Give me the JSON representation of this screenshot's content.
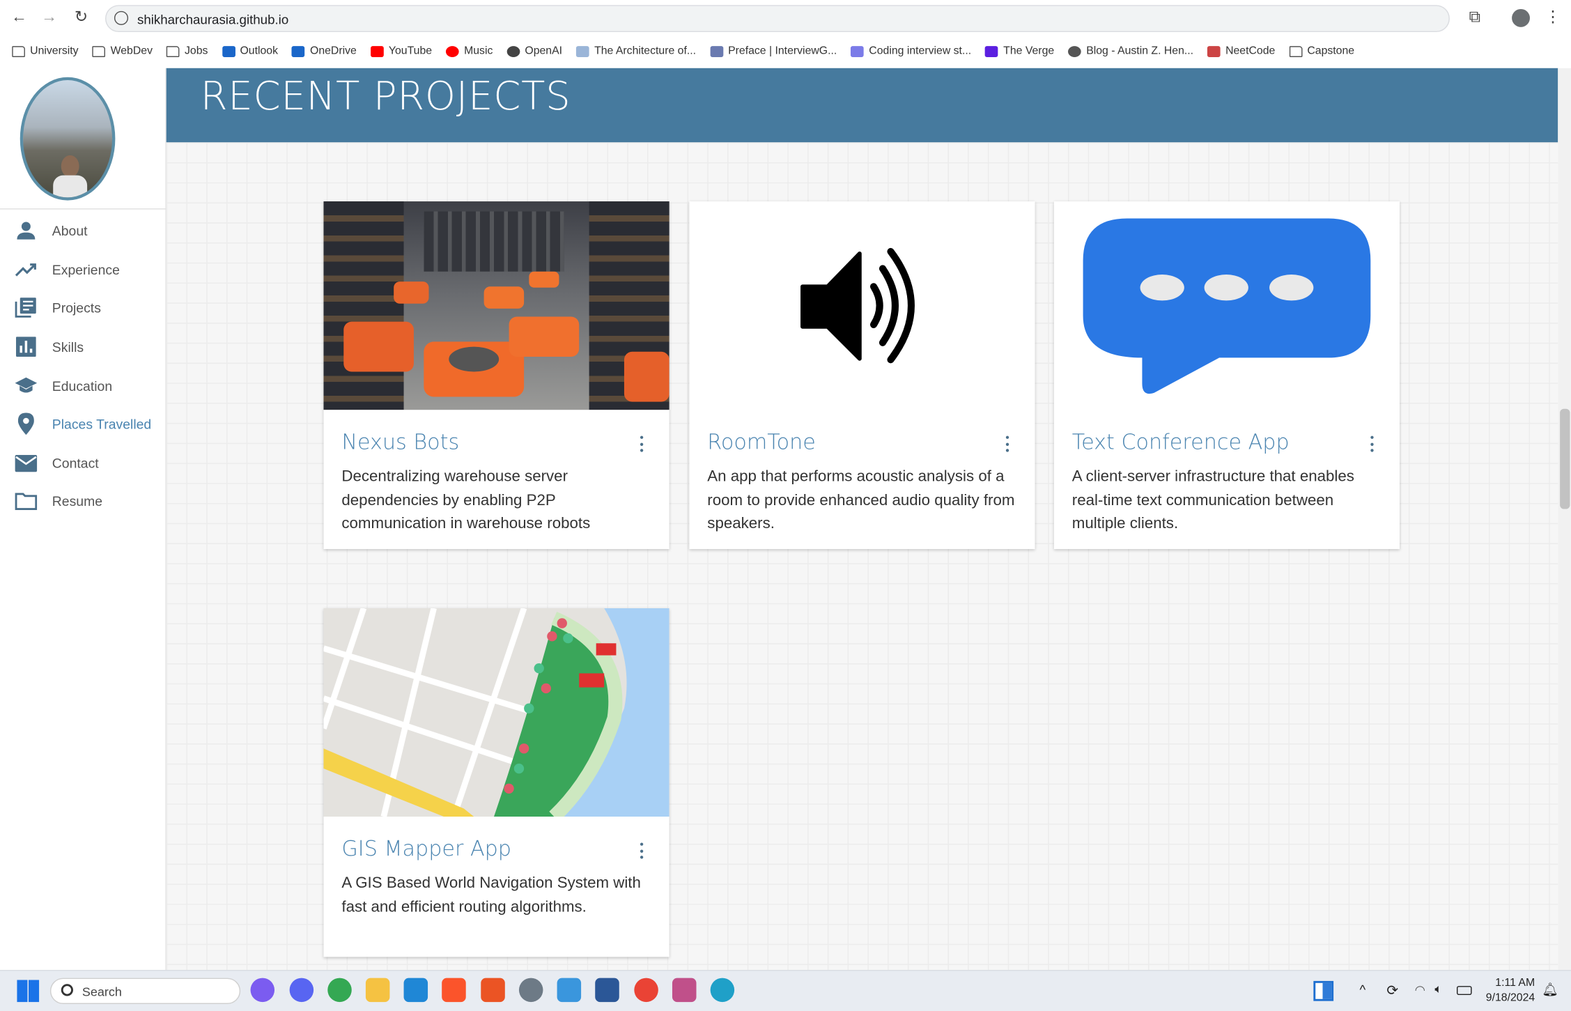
{
  "browser": {
    "url": "shikharchaurasia.github.io",
    "bookmarks": [
      {
        "label": "University",
        "icon": "folder-icon"
      },
      {
        "label": "WebDev",
        "icon": "folder-icon"
      },
      {
        "label": "Jobs",
        "icon": "folder-icon"
      },
      {
        "label": "Outlook",
        "icon": "outlook-icon"
      },
      {
        "label": "OneDrive",
        "icon": "outlook-icon"
      },
      {
        "label": "YouTube",
        "icon": "youtube-icon"
      },
      {
        "label": "Music",
        "icon": "youtube-music-icon"
      },
      {
        "label": "OpenAI",
        "icon": "openai-icon"
      },
      {
        "label": "The Architecture of...",
        "icon": "architecture-icon"
      },
      {
        "label": "Preface | InterviewG...",
        "icon": "books-icon"
      },
      {
        "label": "Coding interview st...",
        "icon": "code-icon"
      },
      {
        "label": "The Verge",
        "icon": "verge-icon"
      },
      {
        "label": "Blog - Austin Z. Hen...",
        "icon": "globe-icon"
      },
      {
        "label": "NeetCode",
        "icon": "rocket-icon"
      },
      {
        "label": "Capstone",
        "icon": "folder-icon"
      }
    ]
  },
  "sidebar": {
    "items": [
      {
        "label": "About",
        "icon": "person-icon"
      },
      {
        "label": "Experience",
        "icon": "trending-up-icon"
      },
      {
        "label": "Projects",
        "icon": "library-books-icon"
      },
      {
        "label": "Skills",
        "icon": "bar-chart-icon"
      },
      {
        "label": "Education",
        "icon": "school-icon"
      },
      {
        "label": "Places Travelled",
        "icon": "location-pin-icon",
        "active": true
      },
      {
        "label": "Contact",
        "icon": "mail-icon"
      },
      {
        "label": "Resume",
        "icon": "folder-icon"
      }
    ]
  },
  "header": {
    "title": "RECENT PROJECTS"
  },
  "projects": [
    {
      "title": "Nexus Bots",
      "description": "Decentralizing warehouse server dependencies by enabling P2P communication in warehouse robots",
      "image": "warehouse-robots"
    },
    {
      "title": "RoomTone",
      "description": "An app that performs acoustic analysis of a room to provide enhanced audio quality from speakers.",
      "image": "speaker-icon"
    },
    {
      "title": "Text Conference App",
      "description": "A client-server infrastructure that enables real-time text communication between multiple clients.",
      "image": "chat-bubble-icon"
    },
    {
      "title": "GIS Mapper App",
      "description": "A GIS Based World Navigation System with fast and efficient routing algorithms.",
      "image": "map"
    }
  ],
  "colors": {
    "accent": "#4a84b0",
    "banner": "#467a9e",
    "chat": "#2a78e4"
  },
  "taskbar": {
    "search_placeholder": "Search",
    "time": "1:11 AM",
    "date": "9/18/2024"
  }
}
